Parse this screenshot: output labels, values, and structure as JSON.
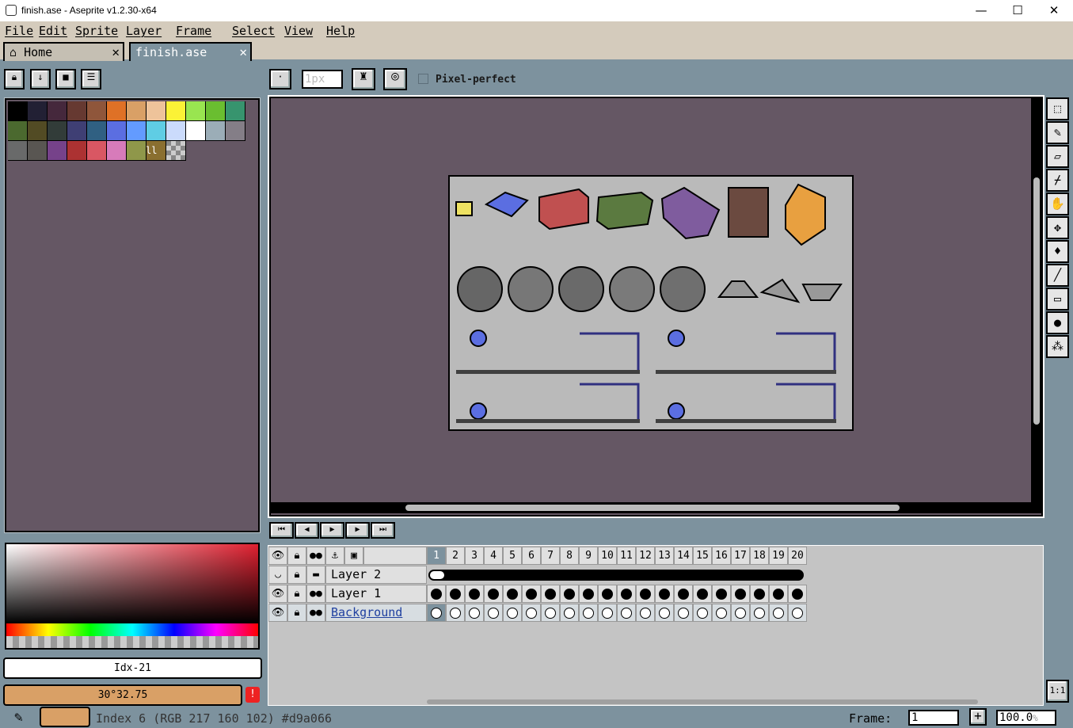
{
  "window": {
    "title": "finish.ase - Aseprite v1.2.30-x64",
    "minimize": "—",
    "maximize": "☐",
    "close": "✕"
  },
  "menu": [
    "File",
    "Edit",
    "Sprite",
    "Layer",
    "Frame",
    "Select",
    "View",
    "Help"
  ],
  "tabs": [
    {
      "label": "Home",
      "icon": "home-icon",
      "close": "✕"
    },
    {
      "label": "finish.ase",
      "close": "✕"
    }
  ],
  "context_bar": {
    "brush_size_value": "1px",
    "pixel_perfect_label": "Pixel-perfect",
    "pixel_perfect_checked": false
  },
  "palette": {
    "colors": [
      "#000000",
      "#222034",
      "#45283c",
      "#663931",
      "#8f563b",
      "#df7126",
      "#d9a066",
      "#eec39a",
      "#fbf236",
      "#99e550",
      "#6abe30",
      "#37946e",
      "#4b692f",
      "#524b24",
      "#323c39",
      "#3f3f74",
      "#306082",
      "#5b6ee1",
      "#639bff",
      "#5fcde4",
      "#cbdbfc",
      "#ffffff",
      "#9badb7",
      "#847e87",
      "#696a6a",
      "#595652",
      "#76428a",
      "#ac3232",
      "#d95763",
      "#d77bba",
      "#8f974a",
      "#8a6f30"
    ],
    "options_icon": "resize-grip-icon"
  },
  "color_box": {
    "index_label": "Idx-21",
    "value_label": "30°32.75"
  },
  "playback": [
    "first-frame-icon",
    "prev-frame-icon",
    "play-icon",
    "next-frame-icon",
    "last-frame-icon"
  ],
  "timeline": {
    "frames": [
      "1",
      "2",
      "3",
      "4",
      "5",
      "6",
      "7",
      "8",
      "9",
      "10",
      "11",
      "12",
      "13",
      "14",
      "15",
      "16",
      "17",
      "18",
      "19",
      "20"
    ],
    "layers": [
      {
        "name": "Layer 2"
      },
      {
        "name": "Layer 1"
      },
      {
        "name": "Background"
      }
    ]
  },
  "status": {
    "color_info": "Index 6 (RGB 217 160 102) #d9a066",
    "frame_label": "Frame:",
    "frame_value": "1",
    "zoom_value": "100.0",
    "zoom_unit": "%",
    "fg_color": "#d9a066"
  },
  "tools": [
    "marquee-icon",
    "pencil-icon",
    "eraser-icon",
    "eyedropper-icon",
    "hand-icon",
    "move-icon",
    "paint-bucket-icon",
    "line-icon",
    "rectangle-icon",
    "contour-icon",
    "spray-icon"
  ],
  "zoom_one": "1:1"
}
